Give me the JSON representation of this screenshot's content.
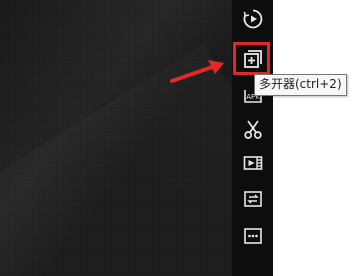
{
  "tooltip": {
    "text": "多开器(ctrl+2)"
  },
  "toolbar": {
    "buttons": [
      {
        "name": "screen-record-icon"
      },
      {
        "name": "multi-open-icon"
      },
      {
        "name": "apk-icon",
        "badge": "APK"
      },
      {
        "name": "scissors-icon"
      },
      {
        "name": "video-icon"
      },
      {
        "name": "sync-icon"
      },
      {
        "name": "more-icon"
      }
    ]
  },
  "colors": {
    "canvas": "#171717",
    "toolbar": "#0d0d0d",
    "icon": "#e8e8e8",
    "highlight": "#e02828",
    "arrow": "#e02828"
  }
}
